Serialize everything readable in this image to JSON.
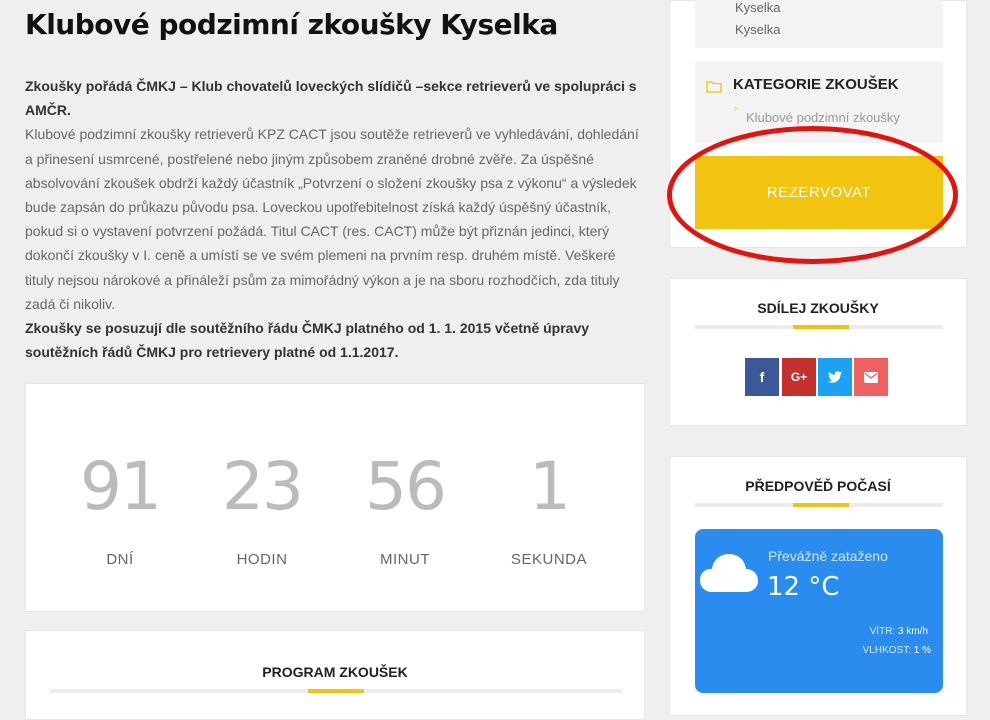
{
  "page": {
    "title": "Klubové podzimní zkoušky Kyselka",
    "intro_bold": "Zkoušky pořádá ČMKJ – Klub chovatelů loveckých slídičů –sekce retrieverů ve spolupráci s AMČR.",
    "intro_text": "Klubové podzimní zkoušky retrieverů KPZ CACT jsou soutěže retrieverů ve vyhledávání, dohledání a přinesení usmrcené, postřelené nebo jiným způsobem zraněné drobné zvěře. Za úspěšné absolvování zkoušek obdrží každý účastník „Potvrzení o složení zkoušky psa z výkonu“ a výsledek bude zapsán do průkazu původu psa. Loveckou upotřebitelnost získá každý úspěšný účastník, pokud si o vystavení potvrzení požádá. Titul CACT (res. CACT) může být přiznán jedinci, který dokončí zkoušky v I. ceně a umístí se ve svém plemeni na prvním resp. druhém místě. Veškeré tituly nejsou nárokové a přináleží psům za mimořádný výkon a je na sboru rozhodčích, zda tituly zadá či nikoliv.",
    "outro_bold": "Zkoušky se posuzují dle soutěžního řádu ČMKJ platného od 1. 1. 2015 včetně úpravy soutěžních řádů ČMKJ pro retrievery platné od 1.1.2017."
  },
  "countdown": [
    {
      "value": "91",
      "label": "DNÍ"
    },
    {
      "value": "23",
      "label": "HODIN"
    },
    {
      "value": "56",
      "label": "MINUT"
    },
    {
      "value": "1",
      "label": "SEKUNDA"
    }
  ],
  "program": {
    "title": "PROGRAM ZKOUŠEK"
  },
  "sidebar": {
    "location_lines": [
      "Kyselka",
      "Kyselka"
    ],
    "category": {
      "title": "KATEGORIE ZKOUŠEK",
      "chevron": "›",
      "link": "Klubové podzimní zkoušky",
      "icon": "folder-icon"
    },
    "reserve_button": "REZERVOVAT",
    "share": {
      "title": "SDÍLEJ ZKOUŠKY",
      "buttons": [
        {
          "icon": "facebook-icon",
          "glyph": "f",
          "color": "#3b5998"
        },
        {
          "icon": "google-plus-icon",
          "glyph": "G+",
          "color": "#c4302b"
        },
        {
          "icon": "twitter-icon",
          "glyph": "t",
          "color": "#1da1f2"
        },
        {
          "icon": "email-icon",
          "glyph": "✉",
          "color": "#ef6161"
        }
      ]
    },
    "weather": {
      "title": "PŘEDPOVĚĎ POČASÍ",
      "condition": "Převážně zataženo",
      "temperature": "12 °C",
      "wind_label": "VÍTR:",
      "wind_value": "3 km/h",
      "humidity_label": "VLHKOST:",
      "humidity_value": "1 %",
      "icon": "cloud-icon"
    }
  },
  "colors": {
    "accent": "#f1c40f",
    "highlight_circle": "#e5120e",
    "weather_bg": "#2b8cf0"
  }
}
